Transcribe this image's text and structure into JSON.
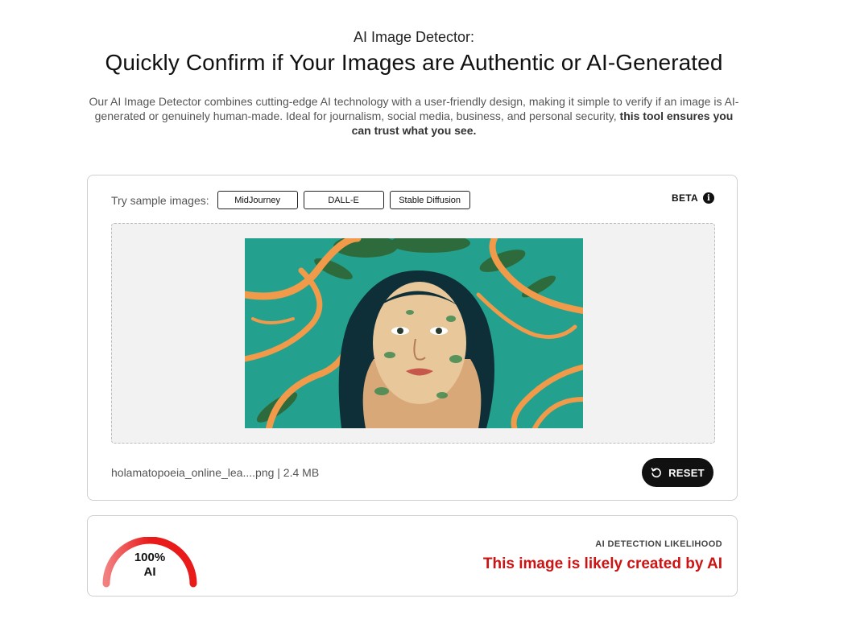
{
  "header": {
    "eyebrow": "AI Image Detector:",
    "title": "Quickly Confirm if Your Images are Authentic or AI-Generated",
    "description": "Our AI Image Detector combines cutting-edge AI technology with a user-friendly design, making it simple to verify if an image is AI-generated or genuinely human-made. Ideal for journalism, social media, business, and personal security,",
    "description_bold": "this tool ensures you can trust what you see."
  },
  "samples": {
    "label": "Try sample images:",
    "buttons": [
      {
        "label": "MidJourney"
      },
      {
        "label": "DALL-E"
      },
      {
        "label": "Stable Diffusion"
      }
    ]
  },
  "beta": {
    "label": "BETA",
    "icon": "info-icon"
  },
  "file": {
    "info": "holamatopoeia_online_lea....png | 2.4 MB"
  },
  "reset": {
    "label": "RESET",
    "icon": "reset-icon"
  },
  "result": {
    "score_value": 100,
    "score_text": "100%",
    "score_unit": "AI",
    "likelihood_label": "AI DETECTION LIKELIHOOD",
    "verdict": "This image is likely created by AI",
    "verdict_color": "#cc1414",
    "gauge_colors": [
      "#f28080",
      "#e81a1a"
    ]
  }
}
